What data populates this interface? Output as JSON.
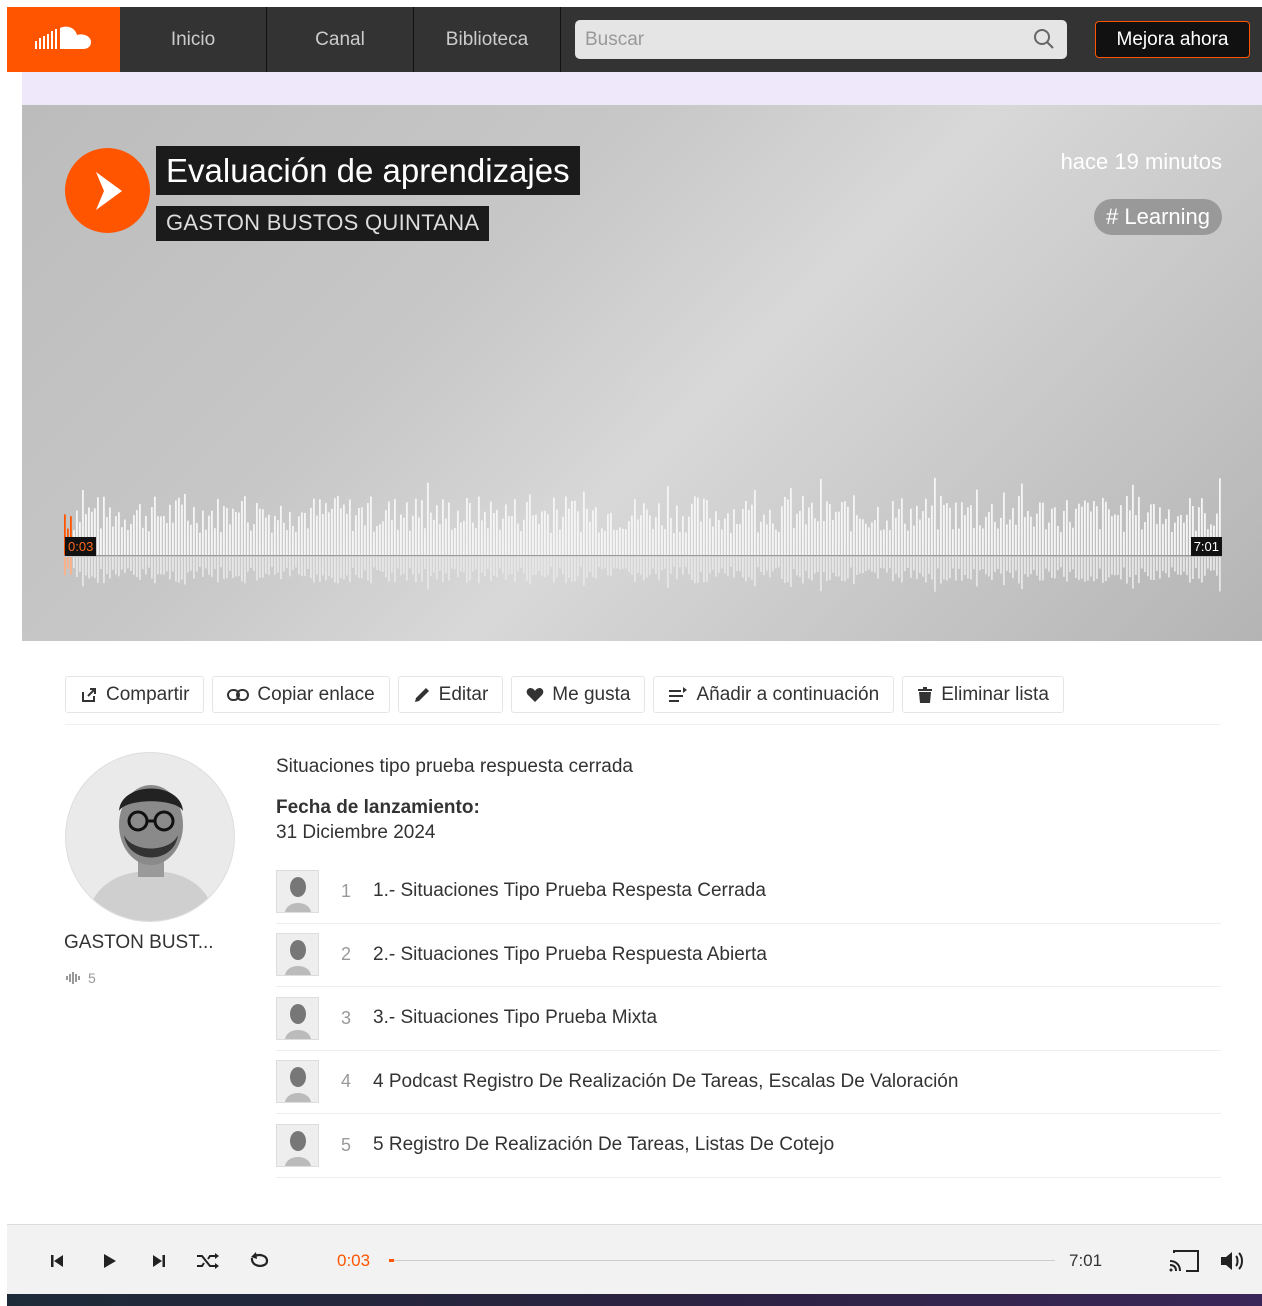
{
  "nav": {
    "items": [
      "Inicio",
      "Canal",
      "Biblioteca"
    ],
    "search_placeholder": "Buscar",
    "upgrade_label": "Mejora ahora"
  },
  "hero": {
    "title": "Evaluación de aprendizajes",
    "artist": "GASTON BUSTOS QUINTANA",
    "posted": "hace 19 minutos",
    "tag": "# Learning",
    "current_time": "0:03",
    "total_time": "7:01"
  },
  "actions": {
    "share": "Compartir",
    "copy_link": "Copiar enlace",
    "edit": "Editar",
    "like": "Me gusta",
    "add_next": "Añadir a continuación",
    "delete_list": "Eliminar lista"
  },
  "artist_panel": {
    "name": "GASTON BUST...",
    "track_count": "5"
  },
  "description": "Situaciones tipo prueba respuesta cerrada",
  "release": {
    "label": "Fecha de lanzamiento:",
    "date": "31 Diciembre 2024"
  },
  "tracks": [
    {
      "num": "1",
      "title": "1.- Situaciones Tipo Prueba Respesta Cerrada"
    },
    {
      "num": "2",
      "title": "2.- Situaciones Tipo Prueba Respuesta Abierta"
    },
    {
      "num": "3",
      "title": "3.- Situaciones Tipo Prueba Mixta"
    },
    {
      "num": "4",
      "title": "4 Podcast Registro De Realización De Tareas, Escalas De Valoración"
    },
    {
      "num": "5",
      "title": "5 Registro De Realización De Tareas, Listas De Cotejo"
    }
  ],
  "player": {
    "current_time": "0:03",
    "total_time": "7:01",
    "progress": 0.007
  },
  "colors": {
    "accent": "#ff5500",
    "nav_bg": "#333333"
  }
}
